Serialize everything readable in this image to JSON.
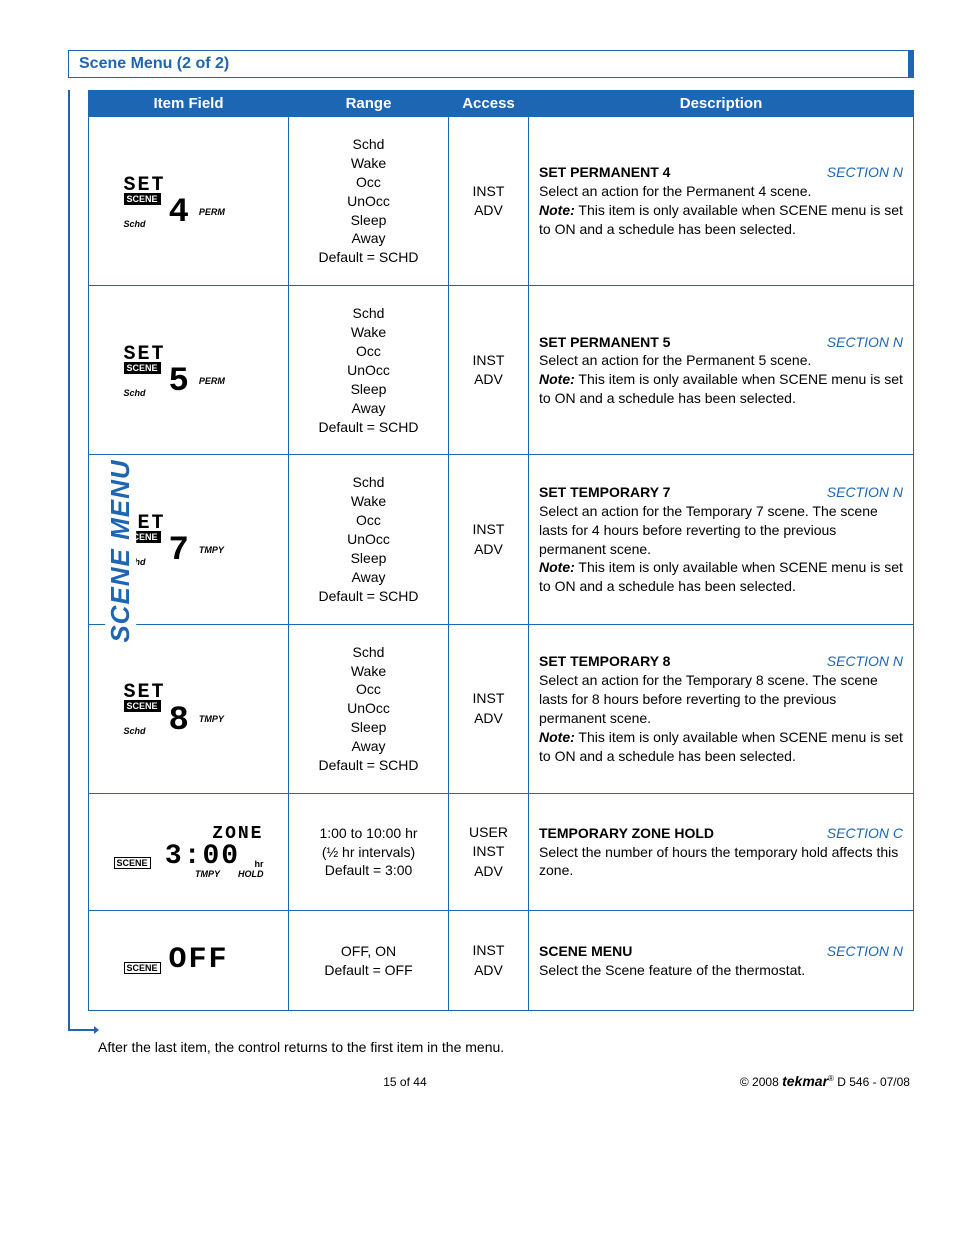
{
  "title": "Scene Menu (2 of 2)",
  "side_label": "SCENE MENU",
  "columns": {
    "c1": "Item Field",
    "c2": "Range",
    "c3": "Access",
    "c4": "Description"
  },
  "range_sched_list": "Schd\nWake\nOcc\nUnOcc\nSleep\nAway\nDefault = SCHD",
  "access_inst_adv": "INST\nADV",
  "access_user_inst_adv": "USER\nINST\nADV",
  "lcd": {
    "set": "SET",
    "scene_tag": "SCENE",
    "perm": "PERM",
    "tmpy": "TMPY",
    "schd": "Schd",
    "hold": "HOLD",
    "hr": "hr",
    "d4": "4",
    "d5": "5",
    "d7": "7",
    "d8": "8",
    "zone": "ZONE",
    "z_val": "3:00",
    "off": "OFF"
  },
  "rows": [
    {
      "title": "SET PERMANENT 4",
      "section": "SECTION N",
      "body": "Select an action for the Permanent 4 scene.",
      "note": "This item is only available when SCENE menu is set to ON and a schedule has been selected."
    },
    {
      "title": "SET PERMANENT 5",
      "section": "SECTION N",
      "body": "Select an action for the Permanent 5 scene.",
      "note": "This item is only available when SCENE menu is set to ON and a schedule has been selected."
    },
    {
      "title": "SET TEMPORARY 7",
      "section": "SECTION N",
      "body": "Select an action for the Temporary 7 scene. The scene lasts for 4 hours before reverting to the previous permanent scene.",
      "note": "This item is only available when SCENE menu is set to ON and a schedule has been selected."
    },
    {
      "title": "SET TEMPORARY 8",
      "section": "SECTION N",
      "body": "Select an action for the Temporary 8 scene. The scene lasts for 8 hours before reverting to the previous permanent scene.",
      "note": "This item is only available when SCENE menu is set to ON and a schedule has been selected."
    },
    {
      "title": "TEMPORARY ZONE HOLD",
      "section": "SECTION C",
      "body": "Select the number of hours the temporary hold affects this zone.",
      "range": "1:00 to 10:00 hr\n(½ hr intervals)\nDefault = 3:00"
    },
    {
      "title": "SCENE MENU",
      "section": "SECTION N",
      "body": "Select the Scene feature of the thermostat.",
      "range": "OFF, ON\nDefault = OFF"
    }
  ],
  "footnote": "After the last item, the control returns to the first item in the menu.",
  "footer": {
    "page": "15 of 44",
    "copyright": "© 2008",
    "brand": "tekmar",
    "doc": " D 546 - 07/08"
  },
  "note_label": "Note:"
}
